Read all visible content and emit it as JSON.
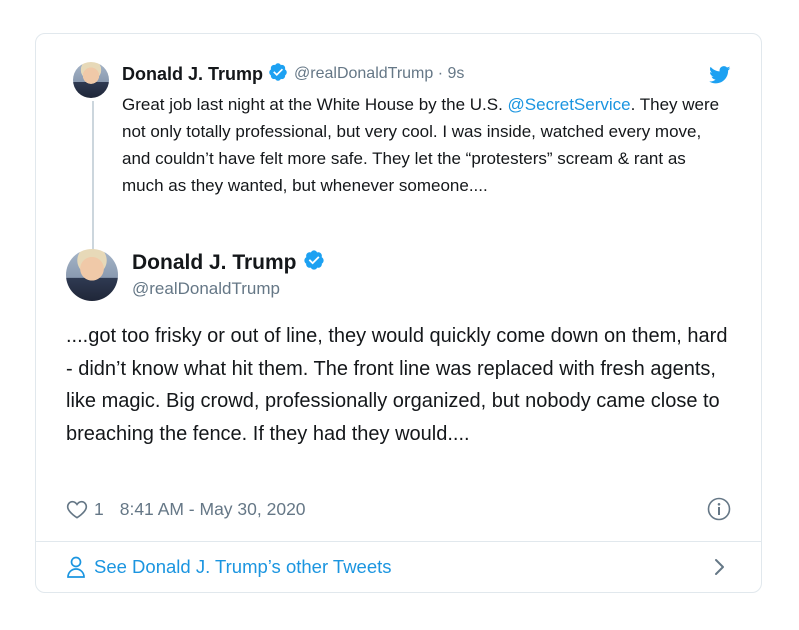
{
  "quoted_tweet": {
    "name": "Donald J. Trump",
    "handle_time": "@realDonaldTrump · 9s",
    "text_before_mention": "Great job last night at the White House by the U.S. ",
    "mention": "@SecretService",
    "text_after_mention": ". They were not only totally professional, but very cool. I was inside, watched every move, and couldn’t have felt more safe. They let the “protesters” scream & rant as much as they wanted, but whenever someone...."
  },
  "main_tweet": {
    "name": "Donald J. Trump",
    "handle": "@realDonaldTrump",
    "text": "....got too frisky or out of line, they would quickly come down on them, hard - didn’t know what hit them. The front line was replaced with fresh agents, like magic. Big crowd, professionally organized, but nobody came close to breaching the fence. If they had they would....",
    "like_count": "1",
    "timestamp": "8:41 AM - May 30, 2020"
  },
  "footer": {
    "link_label": "See Donald J. Trump’s other Tweets"
  },
  "colors": {
    "link": "#1b95e0",
    "muted": "#657786",
    "text": "#14171a",
    "border": "#e1e8ed"
  },
  "icons": [
    "verified-badge-icon",
    "twitter-bird-icon",
    "heart-icon",
    "info-icon",
    "person-icon",
    "chevron-right-icon"
  ]
}
